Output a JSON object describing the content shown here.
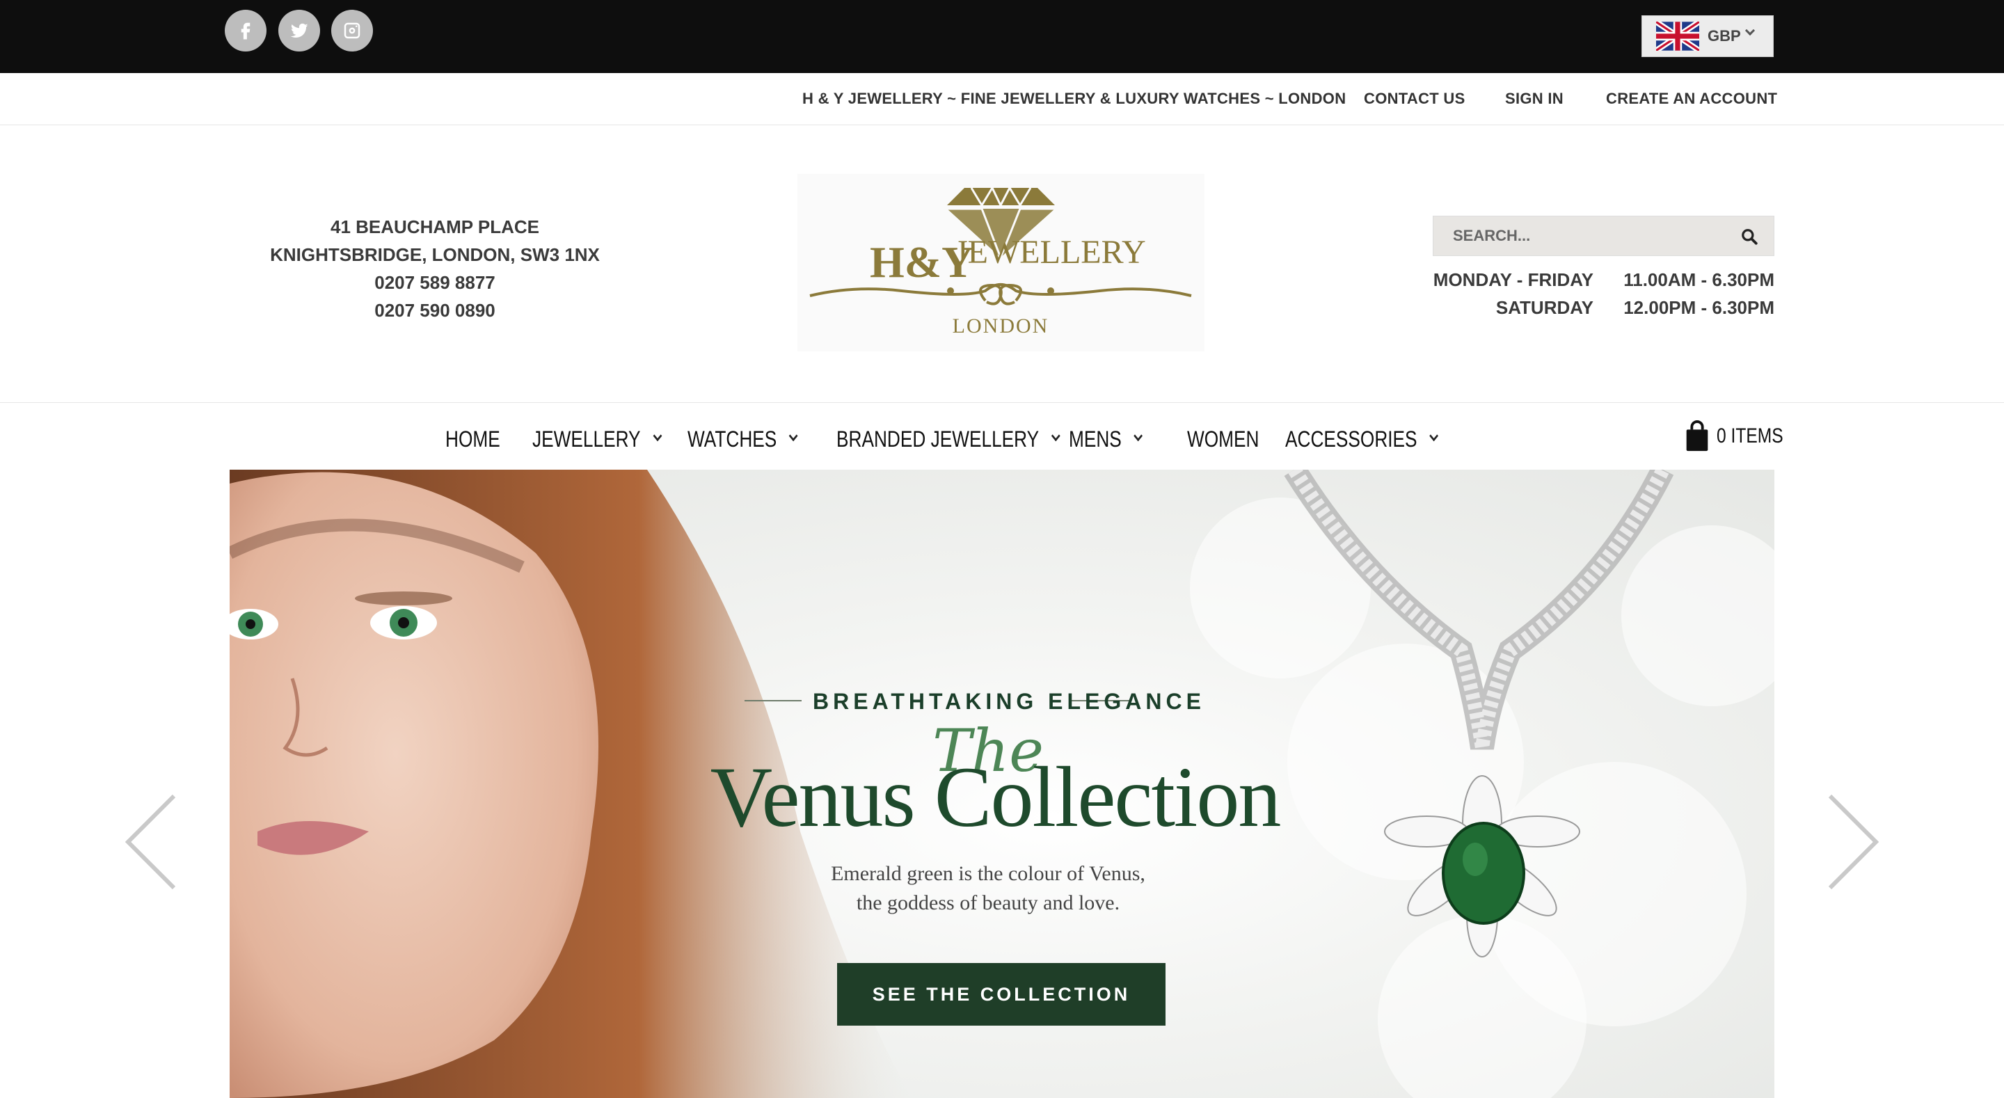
{
  "topbar": {
    "social": [
      {
        "name": "facebook-icon"
      },
      {
        "name": "twitter-icon"
      },
      {
        "name": "instagram-icon"
      }
    ],
    "currency": {
      "code": "GBP",
      "flag": "uk-flag-icon"
    }
  },
  "links": {
    "tagline": "H & Y JEWELLERY ~ FINE JEWELLERY & LUXURY WATCHES ~ LONDON",
    "contact": "CONTACT US",
    "signin": "SIGN IN",
    "create": "CREATE AN ACCOUNT"
  },
  "address": {
    "line1": "41 BEAUCHAMP PLACE",
    "line2": "KNIGHTSBRIDGE, LONDON, SW3 1NX",
    "phone1": "0207 589 8877",
    "phone2": "0207 590 0890"
  },
  "logo": {
    "brand_a": "H&Y",
    "brand_b": "JEWELLERY",
    "city": "LONDON",
    "color": "#8b7a3a"
  },
  "search": {
    "placeholder": "SEARCH..."
  },
  "hours": [
    {
      "day": "MONDAY - FRIDAY",
      "time": "11.00AM - 6.30PM"
    },
    {
      "day": "SATURDAY",
      "time": "12.00PM - 6.30PM"
    }
  ],
  "nav": {
    "items": [
      {
        "label": "HOME",
        "dropdown": false
      },
      {
        "label": "JEWELLERY",
        "dropdown": true
      },
      {
        "label": "WATCHES",
        "dropdown": true
      },
      {
        "label": "BRANDED JEWELLERY",
        "dropdown": true
      },
      {
        "label": "MENS",
        "dropdown": true
      },
      {
        "label": "WOMEN",
        "dropdown": false
      },
      {
        "label": "ACCESSORIES",
        "dropdown": true
      }
    ],
    "cart": "0 ITEMS"
  },
  "hero": {
    "kicker": "BREATHTAKING ELEGANCE",
    "script": "The",
    "headline": "Venus Collection",
    "desc_line1": "Emerald green is the colour of Venus,",
    "desc_line2": "the goddess of beauty and love.",
    "cta": "SEE THE COLLECTION",
    "accent": "#1f3e28"
  }
}
